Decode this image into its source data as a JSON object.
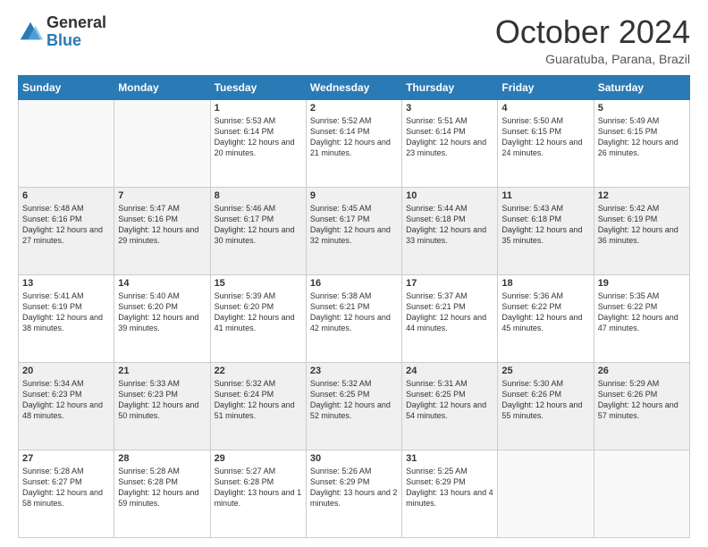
{
  "logo": {
    "general": "General",
    "blue": "Blue"
  },
  "header": {
    "month": "October 2024",
    "location": "Guaratuba, Parana, Brazil"
  },
  "weekdays": [
    "Sunday",
    "Monday",
    "Tuesday",
    "Wednesday",
    "Thursday",
    "Friday",
    "Saturday"
  ],
  "weeks": [
    [
      {
        "day": "",
        "info": ""
      },
      {
        "day": "",
        "info": ""
      },
      {
        "day": "1",
        "info": "Sunrise: 5:53 AM\nSunset: 6:14 PM\nDaylight: 12 hours and 20 minutes."
      },
      {
        "day": "2",
        "info": "Sunrise: 5:52 AM\nSunset: 6:14 PM\nDaylight: 12 hours and 21 minutes."
      },
      {
        "day": "3",
        "info": "Sunrise: 5:51 AM\nSunset: 6:14 PM\nDaylight: 12 hours and 23 minutes."
      },
      {
        "day": "4",
        "info": "Sunrise: 5:50 AM\nSunset: 6:15 PM\nDaylight: 12 hours and 24 minutes."
      },
      {
        "day": "5",
        "info": "Sunrise: 5:49 AM\nSunset: 6:15 PM\nDaylight: 12 hours and 26 minutes."
      }
    ],
    [
      {
        "day": "6",
        "info": "Sunrise: 5:48 AM\nSunset: 6:16 PM\nDaylight: 12 hours and 27 minutes."
      },
      {
        "day": "7",
        "info": "Sunrise: 5:47 AM\nSunset: 6:16 PM\nDaylight: 12 hours and 29 minutes."
      },
      {
        "day": "8",
        "info": "Sunrise: 5:46 AM\nSunset: 6:17 PM\nDaylight: 12 hours and 30 minutes."
      },
      {
        "day": "9",
        "info": "Sunrise: 5:45 AM\nSunset: 6:17 PM\nDaylight: 12 hours and 32 minutes."
      },
      {
        "day": "10",
        "info": "Sunrise: 5:44 AM\nSunset: 6:18 PM\nDaylight: 12 hours and 33 minutes."
      },
      {
        "day": "11",
        "info": "Sunrise: 5:43 AM\nSunset: 6:18 PM\nDaylight: 12 hours and 35 minutes."
      },
      {
        "day": "12",
        "info": "Sunrise: 5:42 AM\nSunset: 6:19 PM\nDaylight: 12 hours and 36 minutes."
      }
    ],
    [
      {
        "day": "13",
        "info": "Sunrise: 5:41 AM\nSunset: 6:19 PM\nDaylight: 12 hours and 38 minutes."
      },
      {
        "day": "14",
        "info": "Sunrise: 5:40 AM\nSunset: 6:20 PM\nDaylight: 12 hours and 39 minutes."
      },
      {
        "day": "15",
        "info": "Sunrise: 5:39 AM\nSunset: 6:20 PM\nDaylight: 12 hours and 41 minutes."
      },
      {
        "day": "16",
        "info": "Sunrise: 5:38 AM\nSunset: 6:21 PM\nDaylight: 12 hours and 42 minutes."
      },
      {
        "day": "17",
        "info": "Sunrise: 5:37 AM\nSunset: 6:21 PM\nDaylight: 12 hours and 44 minutes."
      },
      {
        "day": "18",
        "info": "Sunrise: 5:36 AM\nSunset: 6:22 PM\nDaylight: 12 hours and 45 minutes."
      },
      {
        "day": "19",
        "info": "Sunrise: 5:35 AM\nSunset: 6:22 PM\nDaylight: 12 hours and 47 minutes."
      }
    ],
    [
      {
        "day": "20",
        "info": "Sunrise: 5:34 AM\nSunset: 6:23 PM\nDaylight: 12 hours and 48 minutes."
      },
      {
        "day": "21",
        "info": "Sunrise: 5:33 AM\nSunset: 6:23 PM\nDaylight: 12 hours and 50 minutes."
      },
      {
        "day": "22",
        "info": "Sunrise: 5:32 AM\nSunset: 6:24 PM\nDaylight: 12 hours and 51 minutes."
      },
      {
        "day": "23",
        "info": "Sunrise: 5:32 AM\nSunset: 6:25 PM\nDaylight: 12 hours and 52 minutes."
      },
      {
        "day": "24",
        "info": "Sunrise: 5:31 AM\nSunset: 6:25 PM\nDaylight: 12 hours and 54 minutes."
      },
      {
        "day": "25",
        "info": "Sunrise: 5:30 AM\nSunset: 6:26 PM\nDaylight: 12 hours and 55 minutes."
      },
      {
        "day": "26",
        "info": "Sunrise: 5:29 AM\nSunset: 6:26 PM\nDaylight: 12 hours and 57 minutes."
      }
    ],
    [
      {
        "day": "27",
        "info": "Sunrise: 5:28 AM\nSunset: 6:27 PM\nDaylight: 12 hours and 58 minutes."
      },
      {
        "day": "28",
        "info": "Sunrise: 5:28 AM\nSunset: 6:28 PM\nDaylight: 12 hours and 59 minutes."
      },
      {
        "day": "29",
        "info": "Sunrise: 5:27 AM\nSunset: 6:28 PM\nDaylight: 13 hours and 1 minute."
      },
      {
        "day": "30",
        "info": "Sunrise: 5:26 AM\nSunset: 6:29 PM\nDaylight: 13 hours and 2 minutes."
      },
      {
        "day": "31",
        "info": "Sunrise: 5:25 AM\nSunset: 6:29 PM\nDaylight: 13 hours and 4 minutes."
      },
      {
        "day": "",
        "info": ""
      },
      {
        "day": "",
        "info": ""
      }
    ]
  ]
}
